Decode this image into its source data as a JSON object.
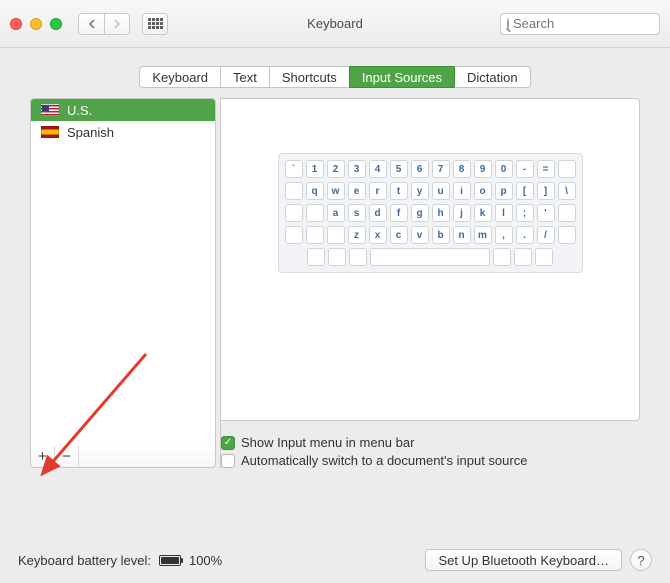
{
  "window": {
    "title": "Keyboard"
  },
  "search": {
    "placeholder": "Search",
    "value": ""
  },
  "tabs": [
    {
      "label": "Keyboard"
    },
    {
      "label": "Text"
    },
    {
      "label": "Shortcuts"
    },
    {
      "label": "Input Sources",
      "active": true
    },
    {
      "label": "Dictation"
    }
  ],
  "sources": [
    {
      "label": "U.S.",
      "flag": "us",
      "selected": true
    },
    {
      "label": "Spanish",
      "flag": "es",
      "selected": false
    }
  ],
  "keyboard_rows": [
    [
      "`",
      "1",
      "2",
      "3",
      "4",
      "5",
      "6",
      "7",
      "8",
      "9",
      "0",
      "-",
      "="
    ],
    [
      "q",
      "w",
      "e",
      "r",
      "t",
      "y",
      "u",
      "i",
      "o",
      "p",
      "[",
      "]",
      "\\"
    ],
    [
      "a",
      "s",
      "d",
      "f",
      "g",
      "h",
      "j",
      "k",
      "l",
      ";",
      "'"
    ],
    [
      "z",
      "x",
      "c",
      "v",
      "b",
      "n",
      "m",
      ",",
      ".",
      "/"
    ]
  ],
  "options": {
    "show_menu_label": "Show Input menu in menu bar",
    "show_menu_checked": true,
    "auto_switch_label": "Automatically switch to a document's input source",
    "auto_switch_checked": false
  },
  "footer": {
    "battery_label": "Keyboard battery level:",
    "battery_value": "100%",
    "bluetooth_button": "Set Up Bluetooth Keyboard…"
  },
  "icons": {
    "add": "+",
    "remove": "−",
    "help": "?"
  }
}
